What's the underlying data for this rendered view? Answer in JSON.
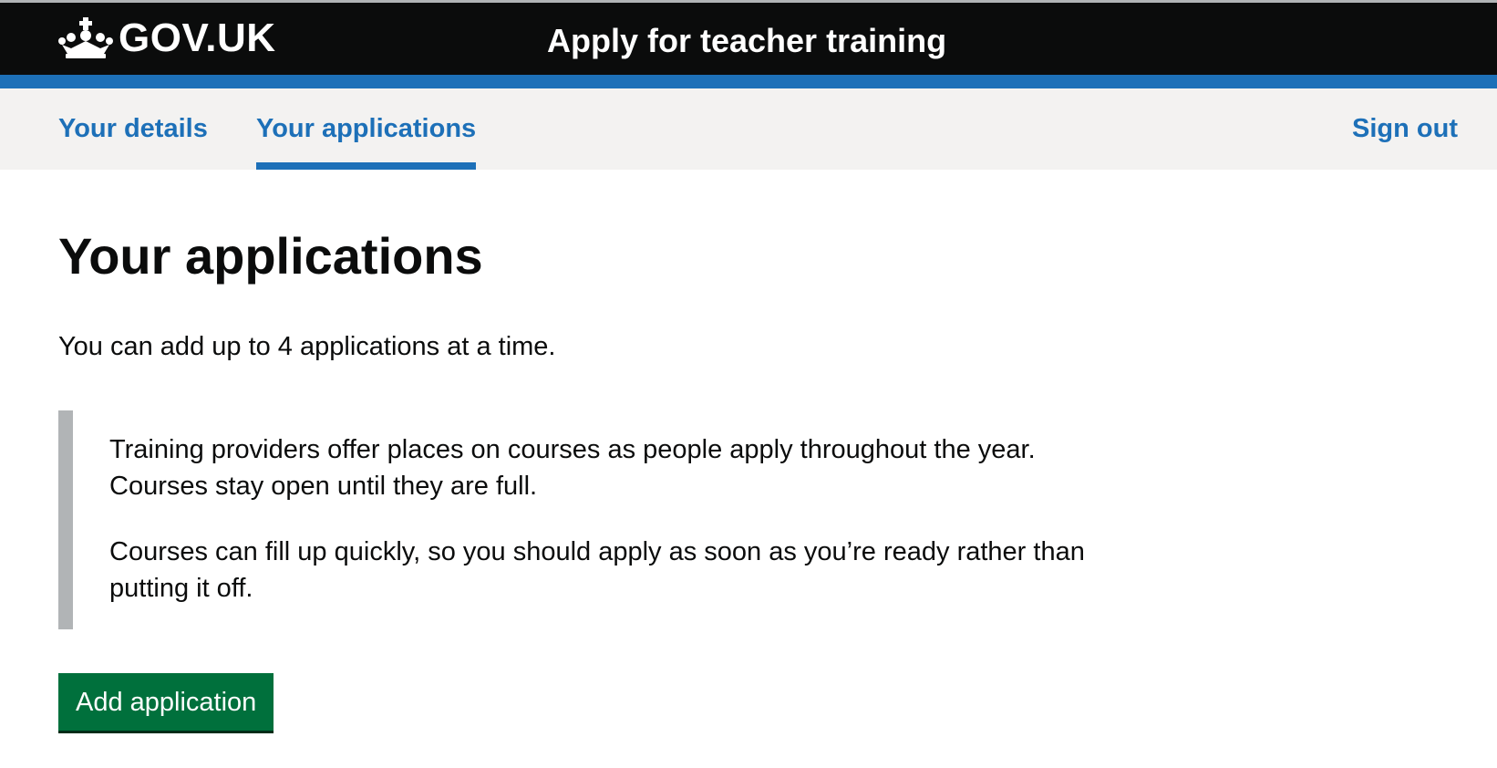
{
  "header": {
    "logo_text": "GOV.UK",
    "logo_icon": "crown-icon",
    "service_name": "Apply for teacher training"
  },
  "nav": {
    "items": [
      {
        "label": "Your details",
        "active": false
      },
      {
        "label": "Your applications",
        "active": true
      }
    ],
    "sign_out": "Sign out"
  },
  "main": {
    "title": "Your applications",
    "lead": "You can add up to 4 applications at a time.",
    "inset": {
      "paragraph_1": "Training providers offer places on courses as people apply throughout the year. Courses stay open until they are full.",
      "paragraph_2": "Courses can fill up quickly, so you should apply as soon as you’re ready rather than putting it off."
    },
    "add_button": "Add application"
  },
  "colors": {
    "header_bg": "#0b0c0c",
    "brand_blue": "#1d70b8",
    "nav_bg": "#f3f2f1",
    "button_green": "#00703c",
    "inset_border": "#b1b4b6"
  }
}
